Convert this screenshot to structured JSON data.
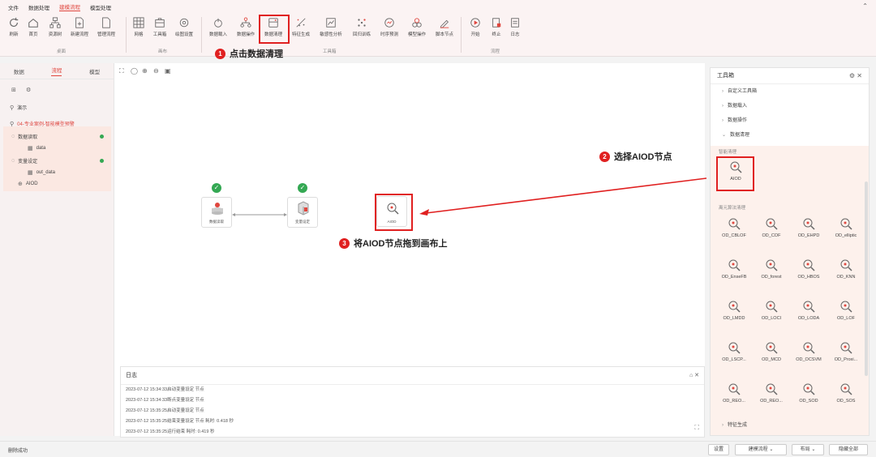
{
  "menu": [
    "文件",
    "数据处理",
    "建模流程",
    "模型处理"
  ],
  "menu_active_index": 2,
  "ribbon": {
    "buttons": [
      {
        "label": "刷新",
        "icon": "refresh-icon"
      },
      {
        "label": "首页",
        "icon": "home-icon"
      },
      {
        "label": "资源树",
        "icon": "tree-icon"
      },
      {
        "label": "新建流程",
        "icon": "new-file-icon"
      },
      {
        "label": "管理流程",
        "icon": "manage-file-icon"
      },
      {
        "label": "网格",
        "icon": "grid-icon"
      },
      {
        "label": "工具箱",
        "icon": "toolbox-icon"
      },
      {
        "label": "绘图设置",
        "icon": "settings-icon"
      },
      {
        "label": "数据载入",
        "icon": "data-load-icon"
      },
      {
        "label": "数据操作",
        "icon": "data-op-icon"
      },
      {
        "label": "数据清理",
        "icon": "data-clean-icon"
      },
      {
        "label": "特征生成",
        "icon": "feature-icon"
      },
      {
        "label": "敏感性分析",
        "icon": "sensitivity-icon"
      },
      {
        "label": "回归训练",
        "icon": "regression-icon"
      },
      {
        "label": "时序预测",
        "icon": "timeseries-icon"
      },
      {
        "label": "模型操作",
        "icon": "model-op-icon"
      },
      {
        "label": "脚本节点",
        "icon": "script-icon"
      },
      {
        "label": "开始",
        "icon": "play-icon"
      },
      {
        "label": "终止",
        "icon": "stop-icon"
      },
      {
        "label": "日志",
        "icon": "log-icon"
      }
    ],
    "groups": [
      "桌面",
      "画布",
      "工具箱",
      "流程"
    ]
  },
  "left": {
    "tabs": [
      "数据",
      "流程",
      "模型"
    ],
    "active_tab": 1,
    "tree": {
      "demo": "演示",
      "project": "04-专业案例-智能模型预警",
      "n1": "数据读取",
      "n1_child": "data",
      "n2": "变量设定",
      "n2_child": "out_data",
      "n3": "AIOD"
    }
  },
  "canvas": {
    "nodes": [
      {
        "label": "数据读取"
      },
      {
        "label": "变量设定"
      },
      {
        "label": "AIOD"
      }
    ]
  },
  "annotations": [
    {
      "num": "1",
      "text": "点击数据清理"
    },
    {
      "num": "2",
      "text": "选择AIOD节点"
    },
    {
      "num": "3",
      "text": "将AIOD节点拖到画布上"
    }
  ],
  "log": {
    "title": "日志",
    "lines": [
      "2023-07-12 15:34:33启动变量设定 节点",
      "2023-07-12 15:34:33断点变量设定 节点",
      "2023-07-12 15:35:25启动变量设定 节点",
      "2023-07-12 15:35:25结束变量设定 节点 耗时: 0.418 秒",
      "2023-07-12 15:35:25运行结束 耗时: 0.419 秒"
    ]
  },
  "toolbox": {
    "title": "工具箱",
    "sections": [
      "自定义工具箱",
      "数据载入",
      "数据操作",
      "数据清理"
    ],
    "smart_clean_label": "智能清理",
    "aiod_label": "AIOD",
    "outlier_label": "离元算法清理",
    "tools": [
      "OD_CBLOF",
      "OD_COF",
      "OD_EHPD",
      "OD_elliptic",
      "OD_EnseFB",
      "OD_forest",
      "OD_HBOS",
      "OD_KNN",
      "OD_LMDD",
      "OD_LOCI",
      "OD_LODA",
      "OD_LOF",
      "OD_LSCP...",
      "OD_MCD",
      "OD_OCSVM",
      "OD_Proxi...",
      "OD_REO...",
      "OD_REO...",
      "OD_SOD",
      "OD_SOS"
    ],
    "last_section": "特征生成"
  },
  "status": {
    "text": "删除成功",
    "buttons": [
      "设置",
      "建模流程",
      "布局",
      "隐藏全部"
    ]
  },
  "colors": {
    "accent": "#e0463e",
    "highlight": "#e02020",
    "success": "#34a853"
  }
}
